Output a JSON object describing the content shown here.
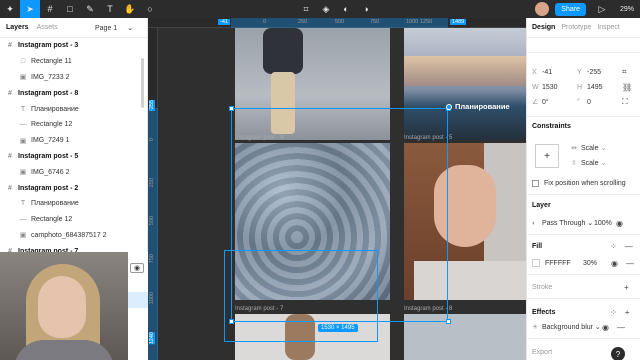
{
  "toolbar": {
    "tools": [
      "move-tool",
      "frame-tool",
      "shape-tool",
      "pen-tool",
      "text-tool",
      "hand-tool",
      "comment-tool"
    ],
    "center_tools": [
      "component-tool",
      "mask-tool",
      "boolean-tool",
      "fill-tool"
    ],
    "avatar_initial": "",
    "share_label": "Share",
    "zoom": "29%"
  },
  "left_panel": {
    "tab_layers": "Layers",
    "tab_assets": "Assets",
    "page": "Page 1",
    "layers": [
      {
        "kind": "frame",
        "icon": "#",
        "name": "Instagram post - 3"
      },
      {
        "kind": "child",
        "icon": "□",
        "name": "Rectangle 11"
      },
      {
        "kind": "child",
        "icon": "▣",
        "name": "IMG_7233 2"
      },
      {
        "kind": "frame",
        "icon": "#",
        "name": "Instagram post - 8"
      },
      {
        "kind": "child",
        "icon": "T",
        "name": "Планирование"
      },
      {
        "kind": "child",
        "icon": "—",
        "name": "Rectangle 12"
      },
      {
        "kind": "child",
        "icon": "▣",
        "name": "IMG_7249 1"
      },
      {
        "kind": "frame",
        "icon": "#",
        "name": "Instagram post - 5"
      },
      {
        "kind": "child",
        "icon": "▣",
        "name": "IMG_6746 2"
      },
      {
        "kind": "frame",
        "icon": "#",
        "name": "Instagram post - 2"
      },
      {
        "kind": "child",
        "icon": "T",
        "name": "Планирование"
      },
      {
        "kind": "child",
        "icon": "—",
        "name": "Rectangle 12"
      },
      {
        "kind": "child",
        "icon": "▣",
        "name": "camphoto_684387517 2"
      },
      {
        "kind": "frame",
        "icon": "#",
        "name": "Instagram post - 7"
      }
    ]
  },
  "canvas": {
    "ruler_top": [
      "-41",
      "0",
      "250",
      "500",
      "750",
      "1000",
      "1250",
      "1489"
    ],
    "ruler_left": [
      "-255",
      "0",
      "250",
      "500",
      "750",
      "1000",
      "1240"
    ],
    "frame_labels": [
      "Instagram post - 4",
      "Instagram post - 5",
      "Instagram post - 7",
      "Instagram post - 8"
    ],
    "selection_label": "Планирование",
    "size_badge": "1530 × 1495"
  },
  "right_panel": {
    "tab_design": "Design",
    "tab_prototype": "Prototype",
    "tab_inspect": "Inspect",
    "x_label": "X",
    "x_value": "-41",
    "y_label": "Y",
    "y_value": "-255",
    "w_label": "W",
    "w_value": "1530",
    "h_label": "H",
    "h_value": "1495",
    "rotation": "0°",
    "radius": "0",
    "constraints_title": "Constraints",
    "constraint_h": "Scale",
    "constraint_v": "Scale",
    "fix_position": "Fix position when scrolling",
    "layer_title": "Layer",
    "blend": "Pass Through",
    "layer_opacity": "100%",
    "fill_title": "Fill",
    "fill_hex": "FFFFFF",
    "fill_opacity": "30%",
    "stroke_title": "Stroke",
    "effects_title": "Effects",
    "effect_name": "Background blur",
    "export_title": "Export"
  },
  "colors": {
    "accent": "#0d99ff",
    "toolbar_bg": "#2c2c2c",
    "canvas_bg": "#2f2f2f"
  }
}
